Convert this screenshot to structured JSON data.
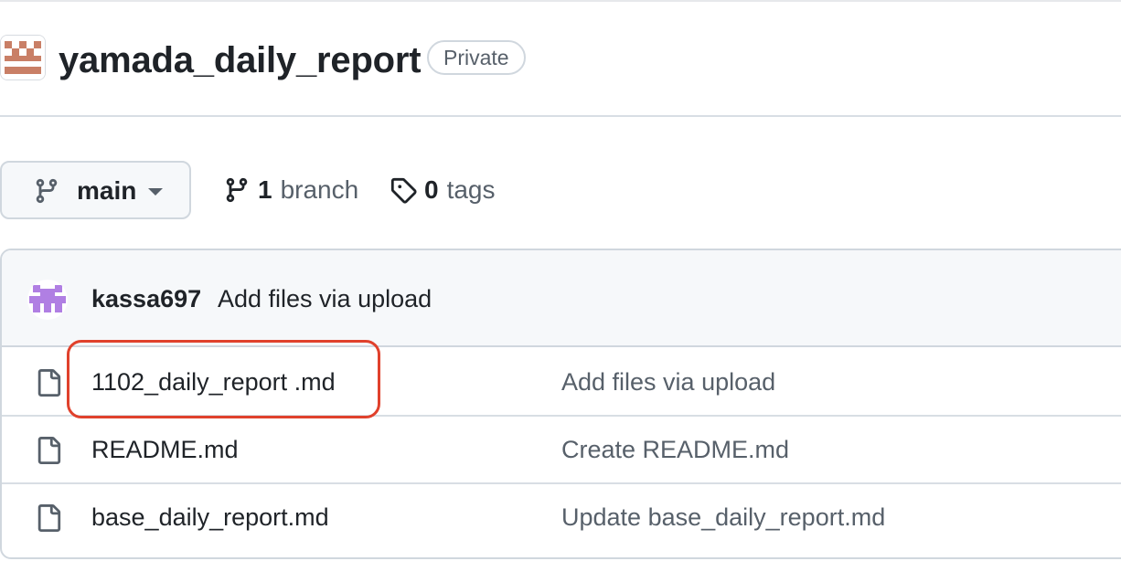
{
  "repo": {
    "name": "yamada_daily_report",
    "visibility": "Private",
    "avatar_icon": "identicon-avatar",
    "avatar_color": "#c97f66"
  },
  "branch_selector": {
    "label": "main",
    "icon": "git-branch-icon"
  },
  "branches": {
    "count": "1",
    "label": "branch",
    "icon": "git-branch-icon"
  },
  "tags": {
    "count": "0",
    "label": "tags",
    "icon": "tag-icon"
  },
  "latest_commit": {
    "author": "kassa697",
    "message": "Add files via upload",
    "avatar_icon": "identicon-avatar",
    "avatar_color": "#b07fe3"
  },
  "files": [
    {
      "name": "1102_daily_report .md",
      "commit": "Add files via upload",
      "icon": "file-icon"
    },
    {
      "name": "README.md",
      "commit": "Create README.md",
      "icon": "file-icon"
    },
    {
      "name": "base_daily_report.md",
      "commit": "Update base_daily_report.md",
      "icon": "file-icon"
    }
  ],
  "colors": {
    "highlight": "#e0412c",
    "text_primary": "#1f2328",
    "text_muted": "#57606a",
    "border": "#d0d7de"
  }
}
